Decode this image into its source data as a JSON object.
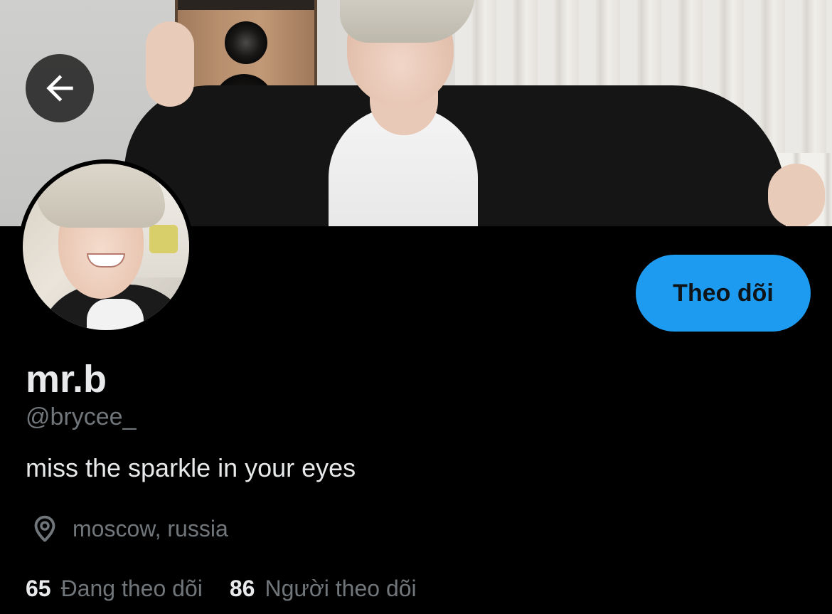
{
  "profile": {
    "display_name": "mr.b",
    "handle": "@brycee_",
    "bio": "miss the sparkle in your eyes",
    "location": "moscow, russia"
  },
  "actions": {
    "follow_label": "Theo dõi"
  },
  "stats": {
    "following_count": "65",
    "following_label": "Đang theo dõi",
    "followers_count": "86",
    "followers_label": "Người theo dõi"
  },
  "icons": {
    "back": "arrow-left-icon",
    "location": "location-pin-icon"
  },
  "colors": {
    "background": "#000000",
    "accent": "#1d9bf0",
    "primary_text": "#e7e9ea",
    "secondary_text": "#71767b"
  }
}
